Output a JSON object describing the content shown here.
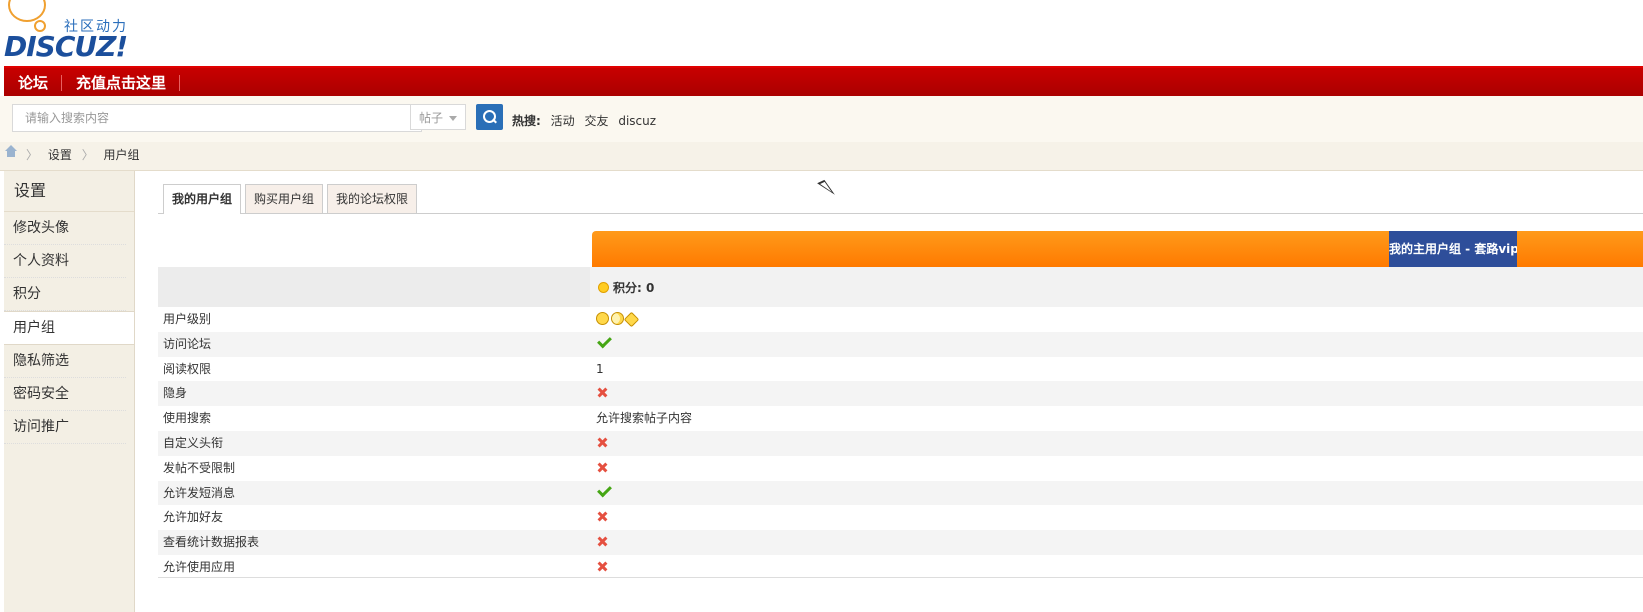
{
  "header": {
    "tagline": "社区动力",
    "brand": "DISCUZ!"
  },
  "nav": {
    "items": [
      {
        "label": "论坛"
      },
      {
        "label": "充值点击这里"
      }
    ]
  },
  "search": {
    "placeholder": "请输入搜索内容",
    "type_value": "帖子",
    "hot_label": "热搜:",
    "hot_words": [
      "活动",
      "交友",
      "discuz"
    ]
  },
  "breadcrumb": {
    "items": [
      "设置",
      "用户组"
    ]
  },
  "sidebar": {
    "title": "设置",
    "items": [
      {
        "label": "修改头像"
      },
      {
        "label": "个人资料"
      },
      {
        "label": "积分"
      },
      {
        "label": "用户组"
      },
      {
        "label": "隐私筛选"
      },
      {
        "label": "密码安全"
      },
      {
        "label": "访问推广"
      }
    ]
  },
  "tabs": {
    "items": [
      {
        "label": "我的用户组"
      },
      {
        "label": "购买用户组"
      },
      {
        "label": "我的论坛权限"
      }
    ]
  },
  "group": {
    "name": "我的主用户组 - 套路vip",
    "points": "积分: 0"
  },
  "permissions": [
    {
      "label": "用户级别",
      "type": "level-icons"
    },
    {
      "label": "访问论坛",
      "type": "check"
    },
    {
      "label": "阅读权限",
      "type": "text",
      "value": "1"
    },
    {
      "label": "隐身",
      "type": "cross"
    },
    {
      "label": "使用搜索",
      "type": "text",
      "value": "允许搜索帖子内容"
    },
    {
      "label": "自定义头衔",
      "type": "cross"
    },
    {
      "label": "发帖不受限制",
      "type": "cross"
    },
    {
      "label": "允许发短消息",
      "type": "check"
    },
    {
      "label": "允许加好友",
      "type": "cross"
    },
    {
      "label": "查看统计数据报表",
      "type": "cross"
    },
    {
      "label": "允许使用应用",
      "type": "cross"
    }
  ],
  "colors": {
    "nav_red": "#b80000",
    "header_orange": "#ff8a00",
    "group_blue": "#2e4e9a",
    "check_green": "#45a614",
    "cross_red": "#e55040"
  }
}
